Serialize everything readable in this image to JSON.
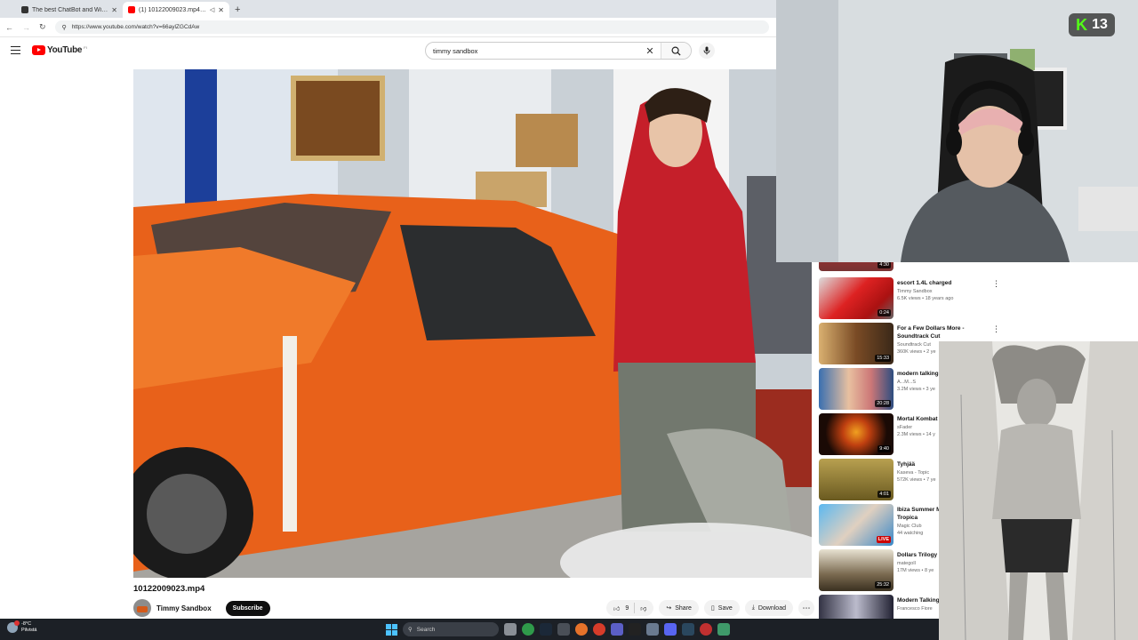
{
  "browser": {
    "tabs": [
      {
        "title": "The best ChatBot and Widgets",
        "active": false,
        "icon": "openai-icon"
      },
      {
        "title": "(1) 10122009023.mp4 - You",
        "active": true,
        "icon": "youtube-icon"
      }
    ],
    "url": "https://www.youtube.com/watch?v=66aylZGCdAw"
  },
  "youtube": {
    "logo_text": "YouTube",
    "logo_region": "FI",
    "search_value": "timmy sandbox"
  },
  "video": {
    "title": "10122009023.mp4",
    "channel": "Timmy Sandbox",
    "subscribe_label": "Subscribe",
    "likes": "9",
    "share_label": "Share",
    "save_label": "Save",
    "download_label": "Download"
  },
  "recommendations": [
    {
      "title": "",
      "channel": "",
      "meta": "",
      "duration": "4:30"
    },
    {
      "title": "escort 1.4L charged",
      "channel": "Timmy Sandbox",
      "meta": "6.5K views • 18 years ago",
      "duration": "0:24"
    },
    {
      "title": "For a Few Dollars More - Soundtrack Cut",
      "channel": "Soundtrack Cut",
      "meta": "360K views • 2 ye",
      "duration": "15:33"
    },
    {
      "title": "modern talking",
      "channel": "A...M...S",
      "meta": "3.2M views • 3 ye",
      "duration": "20:28"
    },
    {
      "title": "Mortal Kombat [Original]",
      "channel": "sFader",
      "meta": "2.3M views • 14 y",
      "duration": "9:40"
    },
    {
      "title": "Tyhjää",
      "channel": "Kasevа - Topic",
      "meta": "572K views • 7 ye",
      "duration": "4:01"
    },
    {
      "title": "Ibiza Summer M Best Of Tropica",
      "channel": "Magic Club",
      "meta": "44 watching",
      "duration": "LIVE"
    },
    {
      "title": "Dollars Trilogy",
      "channel": "mategoll",
      "meta": "17M views • 8 ye",
      "duration": "25:32"
    },
    {
      "title": "Modern Talking",
      "channel": "Francesco Fiore",
      "meta": "",
      "duration": ""
    }
  ],
  "overlay": {
    "kick_letter": "K",
    "kick_count": "13"
  },
  "taskbar": {
    "temperature": "-8°C",
    "weather_text": "Pilvistä",
    "search_placeholder": "Search"
  },
  "colors": {
    "youtube_red": "#ff0000",
    "kick_green": "#53fc18",
    "car_orange": "#e8611a"
  }
}
